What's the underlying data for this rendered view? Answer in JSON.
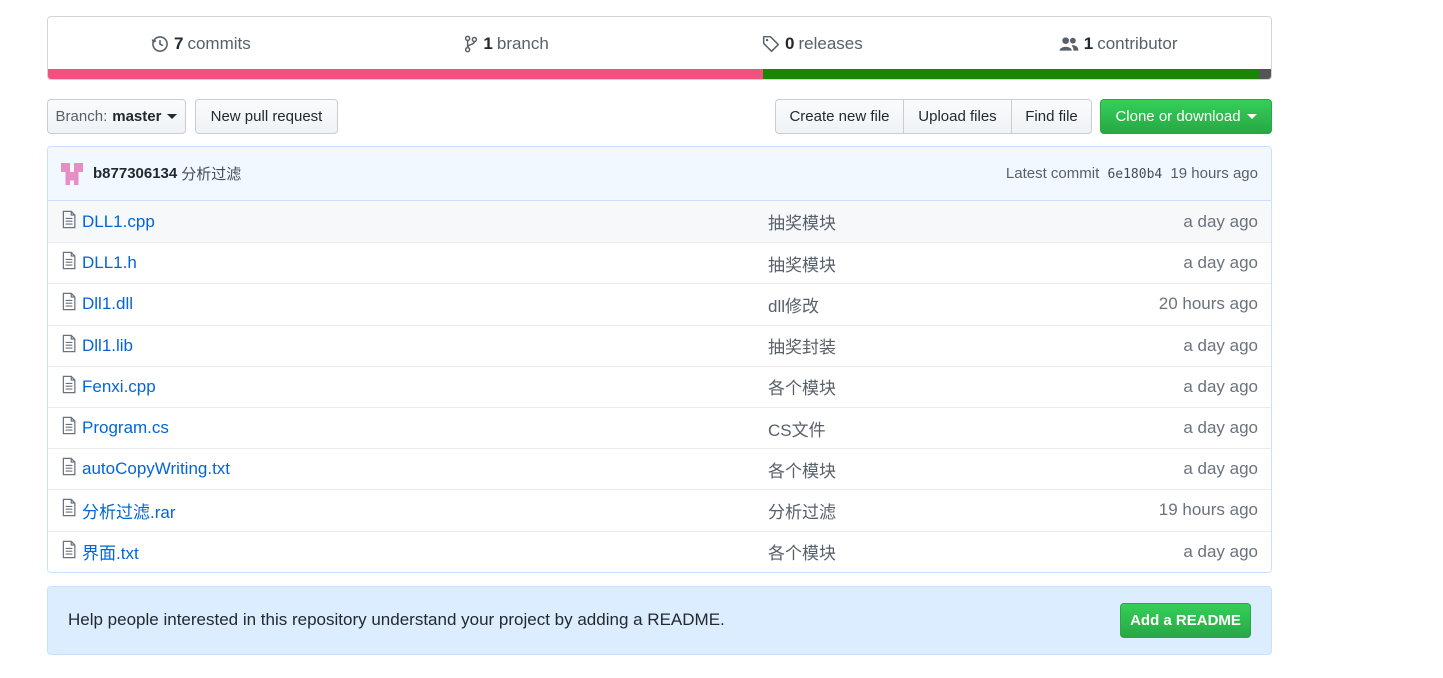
{
  "summary": {
    "commits": {
      "count": "7",
      "label": "commits",
      "icon": "history-icon"
    },
    "branches": {
      "count": "1",
      "label": "branch",
      "icon": "git-branch-icon"
    },
    "releases": {
      "count": "0",
      "label": "releases",
      "icon": "tag-icon"
    },
    "contributors": {
      "count": "1",
      "label": "contributor",
      "icon": "people-icon"
    }
  },
  "languages": [
    {
      "color": "#f1517f",
      "share": 0.585
    },
    {
      "color": "#178600",
      "share": 0.405
    },
    {
      "color": "#555555",
      "share": 0.01
    }
  ],
  "toolbar": {
    "branch_prefix": "Branch:",
    "branch_name": "master",
    "new_pr": "New pull request",
    "create_file": "Create new file",
    "upload_files": "Upload files",
    "find_file": "Find file",
    "clone": "Clone or download"
  },
  "latest_commit": {
    "author": "b877306134",
    "message": "分析过滤",
    "prefix": "Latest commit",
    "sha": "6e180b4",
    "age": "19 hours ago"
  },
  "files": [
    {
      "name": "DLL1.cpp",
      "message": "抽奖模块",
      "age": "a day ago"
    },
    {
      "name": "DLL1.h",
      "message": "抽奖模块",
      "age": "a day ago"
    },
    {
      "name": "Dll1.dll",
      "message": "dll修改",
      "age": "20 hours ago"
    },
    {
      "name": "Dll1.lib",
      "message": "抽奖封装",
      "age": "a day ago"
    },
    {
      "name": "Fenxi.cpp",
      "message": "各个模块",
      "age": "a day ago"
    },
    {
      "name": "Program.cs",
      "message": "CS文件",
      "age": "a day ago"
    },
    {
      "name": "autoCopyWriting.txt",
      "message": "各个模块",
      "age": "a day ago"
    },
    {
      "name": "分析过滤.rar",
      "message": "分析过滤",
      "age": "19 hours ago"
    },
    {
      "name": "界面.txt",
      "message": "各个模块",
      "age": "a day ago"
    }
  ],
  "readme": {
    "text": "Help people interested in this repository understand your project by adding a README.",
    "button": "Add a README"
  }
}
